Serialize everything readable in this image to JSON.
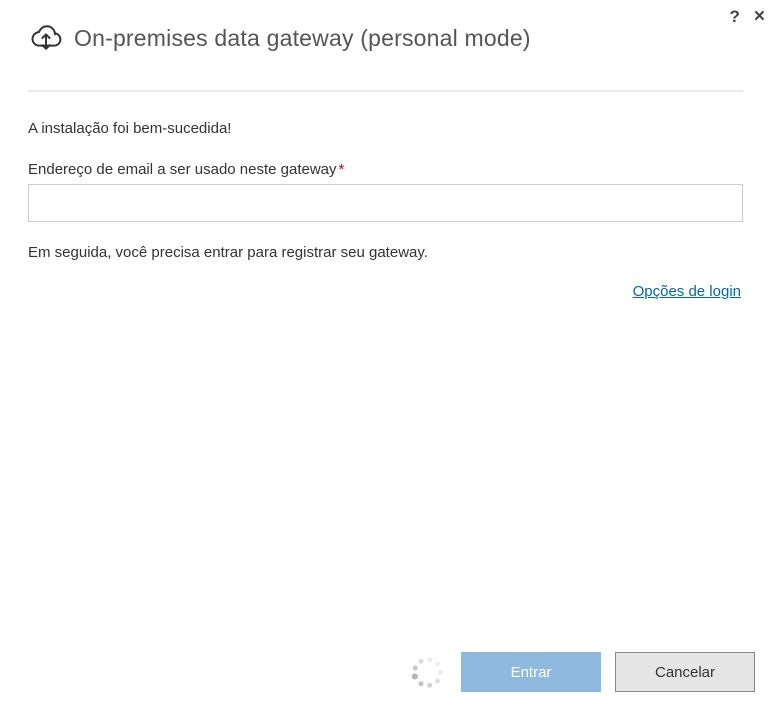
{
  "header": {
    "title": "On-premises data gateway (personal mode)"
  },
  "content": {
    "success_message": "A instalação foi bem-sucedida!",
    "email_label": "Endereço de email a ser usado neste gateway",
    "email_value": "",
    "hint": "Em seguida, você precisa entrar para registrar seu gateway.",
    "login_options_link": "Opções de login"
  },
  "footer": {
    "signin_label": "Entrar",
    "cancel_label": "Cancelar"
  }
}
